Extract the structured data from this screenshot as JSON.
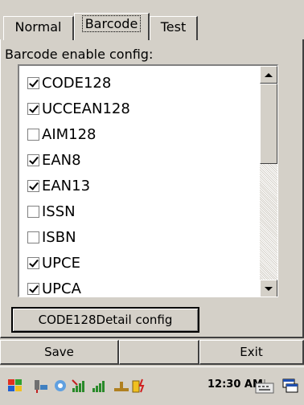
{
  "tabs": [
    {
      "label": "Normal",
      "active": false
    },
    {
      "label": "Barcode",
      "active": true
    },
    {
      "label": "Test",
      "active": false
    }
  ],
  "config_label": "Barcode enable config:",
  "barcodes": [
    {
      "label": "CODE128",
      "checked": true
    },
    {
      "label": "UCCEAN128",
      "checked": true
    },
    {
      "label": "AIM128",
      "checked": false
    },
    {
      "label": "EAN8",
      "checked": true
    },
    {
      "label": "EAN13",
      "checked": true
    },
    {
      "label": "ISSN",
      "checked": false
    },
    {
      "label": "ISBN",
      "checked": false
    },
    {
      "label": "UPCE",
      "checked": true
    },
    {
      "label": "UPCA",
      "checked": true
    }
  ],
  "detail_button": "CODE128Detail config",
  "footer": {
    "save_label": "Save",
    "exit_label": "Exit"
  },
  "taskbar": {
    "clock": "12:30 AM",
    "icons": [
      "start-icon",
      "network-icon",
      "sync-icon",
      "signal-icon",
      "signal-bars-icon",
      "connection-icon",
      "battery-icon",
      "keyboard-icon",
      "window-icon"
    ]
  }
}
